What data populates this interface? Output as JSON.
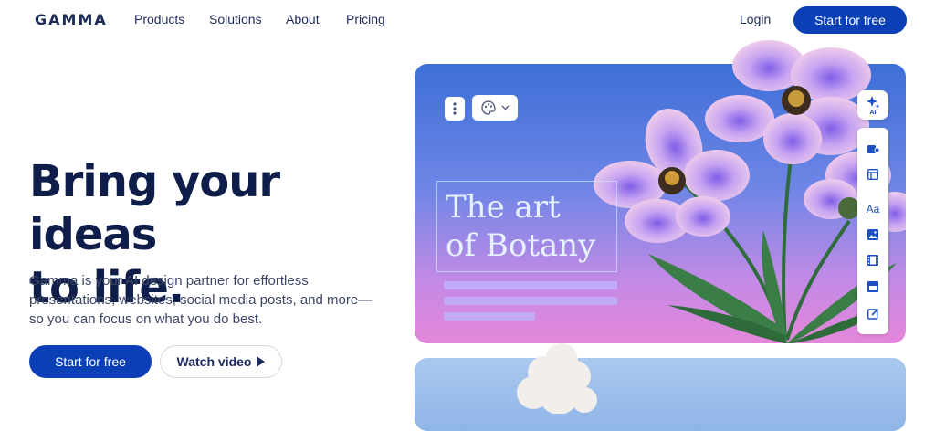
{
  "brand": {
    "logo": "GAMMA"
  },
  "nav": {
    "links": [
      "Products",
      "Solutions",
      "About",
      "Pricing"
    ],
    "login": "Login",
    "cta": "Start for free"
  },
  "hero": {
    "title_line1": "Bring your ideas",
    "title_line2": "to life.",
    "subtitle": "Gamma is your AI design partner for effortless presentations, websites, social media posts, and more—so you can focus on what you do best.",
    "primary_cta": "Start for free",
    "secondary_cta": "Watch video"
  },
  "preview": {
    "title_line1": "The art",
    "title_line2": "of Botany",
    "ai_badge": "AI",
    "font_tool_label": "Aa"
  },
  "colors": {
    "primary": "#0b3fb5",
    "heading": "#0f1d4a",
    "card_top": "#3d6fd8",
    "card_bottom": "#e487da"
  },
  "icons": {
    "more": "more-vertical-icon",
    "theme": "palette-icon",
    "ai": "sparkle-ai-icon",
    "play": "play-icon"
  }
}
